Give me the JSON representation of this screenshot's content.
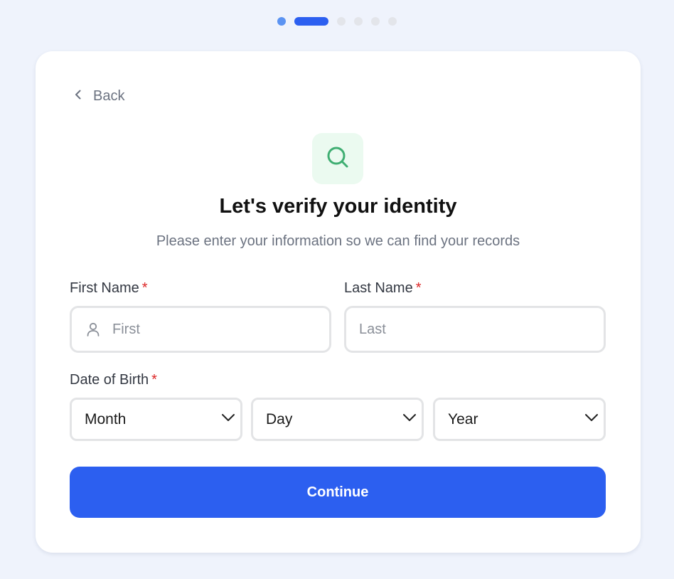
{
  "progress": {
    "total_steps": 6,
    "current_step": 2
  },
  "back": {
    "label": "Back"
  },
  "header": {
    "icon": "search-icon",
    "title": "Let's verify your identity",
    "subtitle": "Please enter your information so we can find your records"
  },
  "form": {
    "first_name": {
      "label": "First Name",
      "required_mark": "*",
      "placeholder": "First",
      "icon": "user-icon"
    },
    "last_name": {
      "label": "Last Name",
      "required_mark": "*",
      "placeholder": "Last"
    },
    "dob": {
      "label": "Date of Birth",
      "required_mark": "*",
      "month": "Month",
      "day": "Day",
      "year": "Year"
    },
    "continue_label": "Continue"
  },
  "colors": {
    "primary": "#2c5ff0",
    "step_done": "#5b93f2",
    "step_pending": "#e3e5ea",
    "required": "#dc2626",
    "icon_accent": "#3fae72",
    "icon_bg": "#ebfaf0",
    "page_bg": "#eff3fc"
  }
}
